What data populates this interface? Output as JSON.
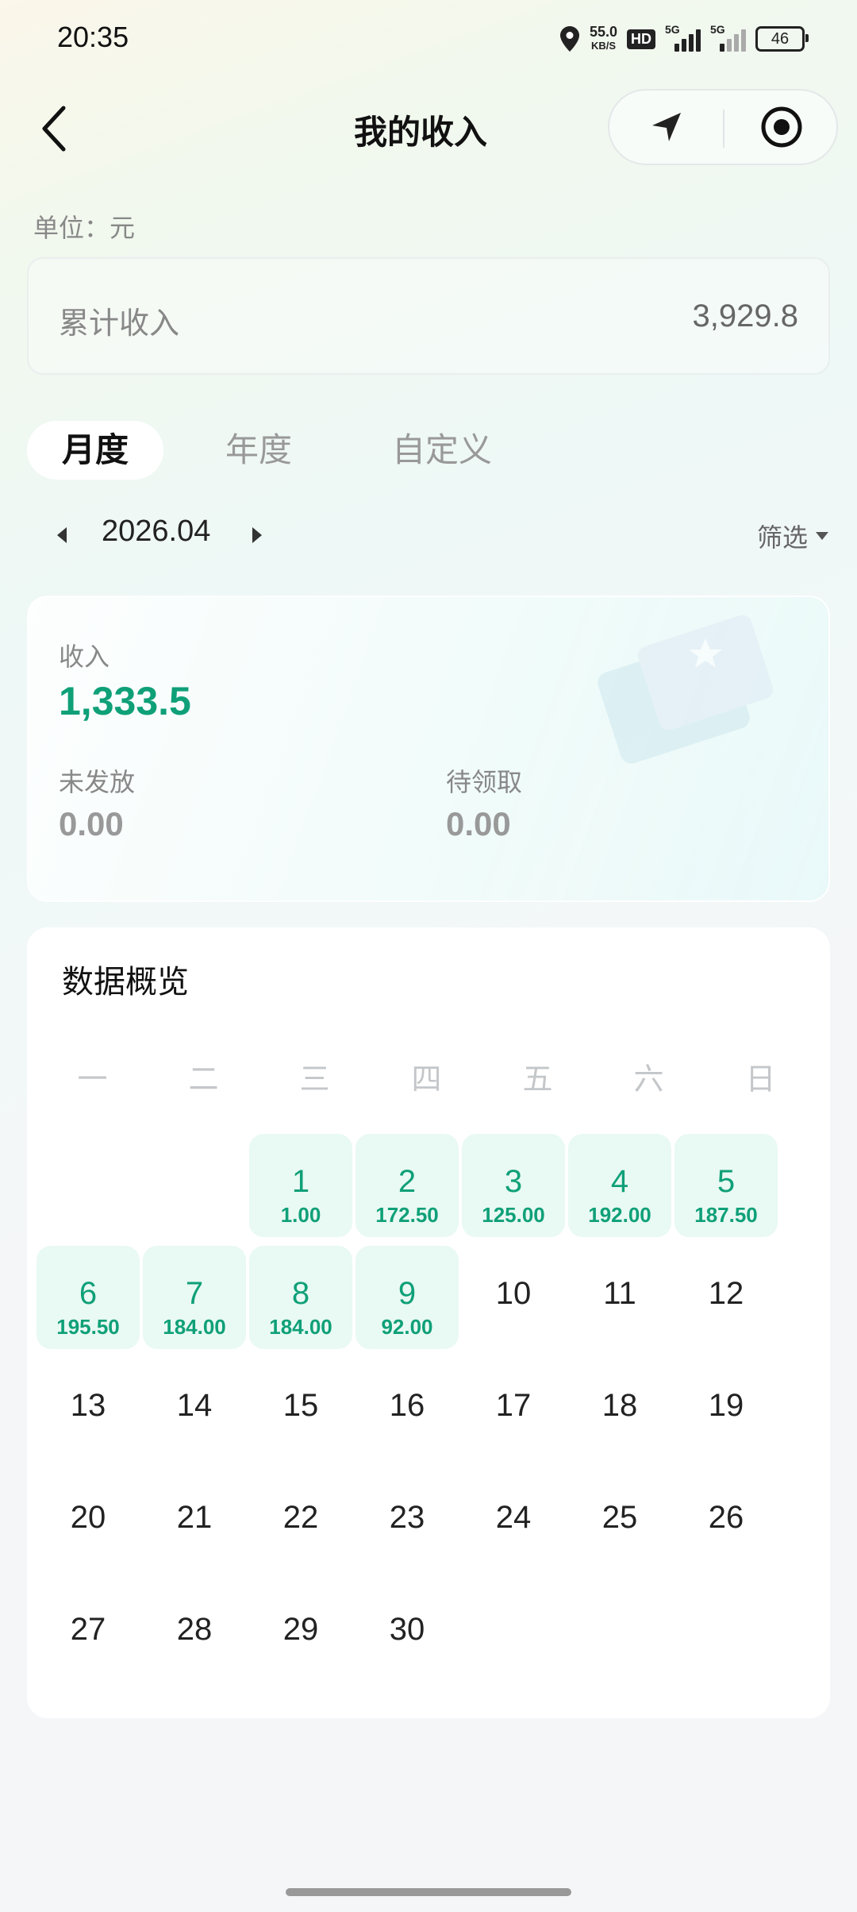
{
  "status_bar": {
    "time": "20:35",
    "net_speed": "55.0",
    "net_unit": "KB/S",
    "hd": "HD",
    "sig1": "5G",
    "sig2": "5G",
    "battery": "46"
  },
  "header": {
    "title": "我的收入"
  },
  "unit_text": "单位：元",
  "total": {
    "label": "累计收入",
    "value": "3,929.8"
  },
  "tabs": [
    {
      "label": "月度"
    },
    {
      "label": "年度"
    },
    {
      "label": "自定义"
    }
  ],
  "month": {
    "value": "2026.04",
    "filter_label": "筛选"
  },
  "income": {
    "label": "收入",
    "value": "1,333.5",
    "unissued_label": "未发放",
    "unissued_value": "0.00",
    "pending_label": "待领取",
    "pending_value": "0.00"
  },
  "overview": {
    "title": "数据概览",
    "weekdays": [
      "一",
      "二",
      "三",
      "四",
      "五",
      "六",
      "日"
    ],
    "first_weekday_index": 2,
    "days_in_month": 30,
    "day_amounts": {
      "1": "1.00",
      "2": "172.50",
      "3": "125.00",
      "4": "192.00",
      "5": "187.50",
      "6": "195.50",
      "7": "184.00",
      "8": "184.00",
      "9": "92.00"
    }
  }
}
